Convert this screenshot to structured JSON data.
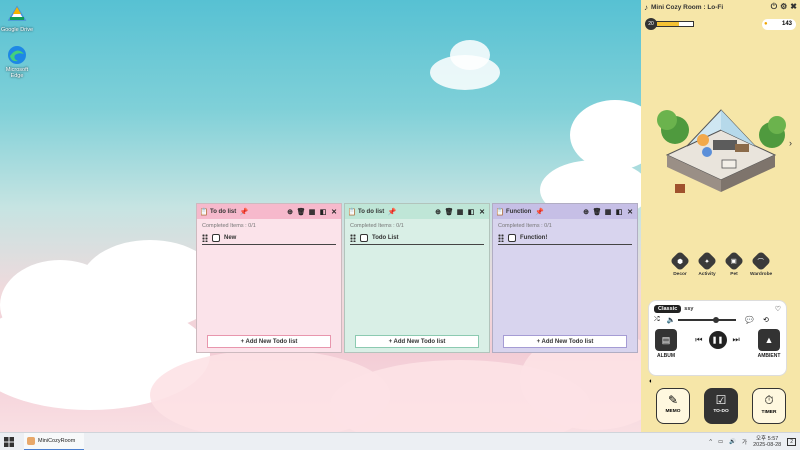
{
  "desktop": {
    "icons": [
      {
        "label": "Google Drive",
        "icon": "google-drive-icon"
      },
      {
        "label": "Microsoft Edge",
        "icon": "edge-icon"
      }
    ]
  },
  "panels": [
    {
      "title": "To do list",
      "completed": "Completed Items : 0/1",
      "item": "New",
      "add_label": "+ Add New Todo list",
      "bg": "#fbe3ea",
      "header_bg": "#f6b9cc",
      "accent": "#e896ad"
    },
    {
      "title": "To do list",
      "completed": "Completed Items : 0/1",
      "item": "Todo List",
      "add_label": "+ Add New Todo list",
      "bg": "#d9efe6",
      "header_bg": "#bfe6d7",
      "accent": "#8ccab1"
    },
    {
      "title": "Function",
      "completed": "Completed Items : 0/1",
      "item": "Function!",
      "add_label": "+ Add New Todo list",
      "bg": "#d8d4ee",
      "header_bg": "#c6bfe6",
      "accent": "#a59cd4"
    }
  ],
  "app": {
    "title": "Mini Cozy Room : Lo-Fi",
    "level": "20",
    "xp_fraction": 0.6,
    "coins": "143",
    "menu": [
      {
        "label": "Decor",
        "icon": "decor-icon"
      },
      {
        "label": "Activity",
        "icon": "activity-icon"
      },
      {
        "label": "Pet",
        "icon": "pet-icon"
      },
      {
        "label": "Wardrobe",
        "icon": "wardrobe-icon"
      }
    ],
    "player": {
      "genre": "Classic",
      "track": "ssy",
      "album_label": "ALBUM",
      "ambient_label": "AMBIENT",
      "volume_fraction": 0.6
    },
    "bottom": [
      {
        "label": "MEMO",
        "icon": "memo-icon"
      },
      {
        "label": "TO-DO",
        "icon": "todo-icon"
      },
      {
        "label": "TIMER",
        "icon": "timer-icon"
      }
    ]
  },
  "taskbar": {
    "app_label": "MiniCozyRoom",
    "time": "오후 5:57",
    "date": "2025-08-28",
    "notif_count": "2"
  }
}
